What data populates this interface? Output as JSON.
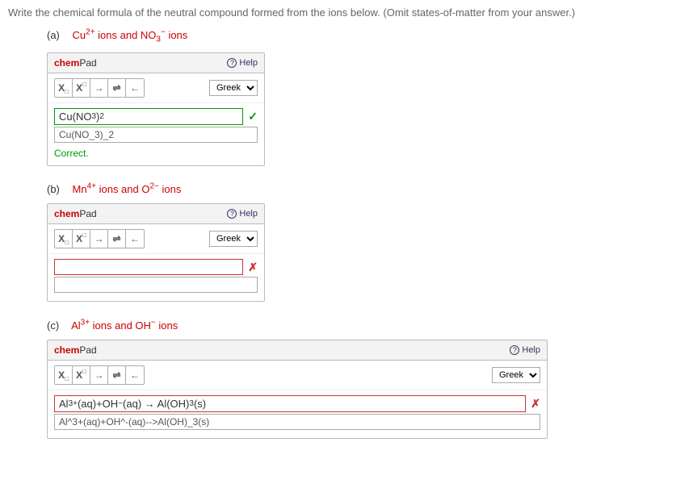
{
  "question": "Write the chemical formula of the neutral compound formed from the ions below. (Omit states-of-matter from your answer.)",
  "parts": {
    "a": {
      "letter": "(a)",
      "ion_html": "Cu<sup>2+</sup> ions and NO<sub>3</sub><sup>−</sup> ions"
    },
    "b": {
      "letter": "(b)",
      "ion_html": "Mn<sup>4+</sup> ions and O<sup>2−</sup> ions"
    },
    "c": {
      "letter": "(c)",
      "ion_html": "Al<sup>3+</sup> ions and OH<sup>−</sup> ions"
    }
  },
  "chempad": {
    "title_chem": "chem",
    "title_pad": "Pad",
    "help": "Help",
    "greek": "Greek",
    "arrow_r": "→",
    "arrow_eq": "⇌",
    "arrow_l": "←"
  },
  "answers": {
    "a": {
      "display_html": "Cu(NO<sub>3</sub>)<sub>2</sub>",
      "raw": "Cu(NO_3)_2",
      "feedback": "Correct."
    },
    "b": {
      "display": "",
      "raw": ""
    },
    "c": {
      "display_html": "Al<sup>3+</sup>(aq)+OH<sup>−</sup>(aq) → Al(OH)<sub>3</sub>(s)",
      "raw": "Al^3+(aq)+OH^-(aq)-->Al(OH)_3(s)"
    }
  }
}
